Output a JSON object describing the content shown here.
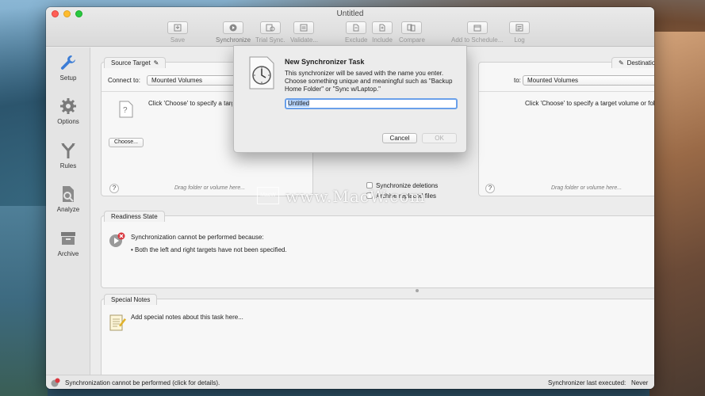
{
  "window": {
    "title": "Untitled"
  },
  "toolbar": {
    "items": [
      {
        "label": "Save",
        "icon": "save-icon"
      },
      {
        "label": "Synchronize",
        "icon": "play-icon"
      },
      {
        "label": "Trial Sync.",
        "icon": "trial-sync-icon"
      },
      {
        "label": "Validate...",
        "icon": "checklist-icon"
      },
      {
        "label": "Exclude",
        "icon": "exclude-icon"
      },
      {
        "label": "Include",
        "icon": "include-icon"
      },
      {
        "label": "Compare",
        "icon": "compare-icon"
      },
      {
        "label": "Add to Schedule...",
        "icon": "schedule-icon"
      },
      {
        "label": "Log",
        "icon": "log-icon"
      }
    ]
  },
  "sidebar": {
    "items": [
      {
        "label": "Setup",
        "icon": "wrench-icon"
      },
      {
        "label": "Options",
        "icon": "gear-icon"
      },
      {
        "label": "Rules",
        "icon": "rules-icon"
      },
      {
        "label": "Analyze",
        "icon": "analyze-icon"
      },
      {
        "label": "Archive",
        "icon": "archive-icon"
      }
    ]
  },
  "source": {
    "tab": "Source Target",
    "connect_label": "Connect to:",
    "connect_value": "Mounted Volumes",
    "instruction": "Click 'Choose' to specify a target volume or folder...",
    "choose_button": "Choose...",
    "help": "?",
    "drag_hint": "Drag folder or volume here..."
  },
  "destination": {
    "tab": "Destination Target",
    "connect_label": "to:",
    "connect_value": "Mounted Volumes",
    "instruction": "Click 'Choose' to specify a target volume or folder...",
    "help": "?",
    "drag_hint": "Drag folder or volume here..."
  },
  "middle": {
    "sync_deletions": "Synchronize deletions",
    "archive_replaced": "Archive replaced files"
  },
  "readiness": {
    "tab": "Readiness State",
    "heading": "Synchronization cannot be performed because:",
    "reason": "•  Both the left and right targets have not been specified.",
    "help": "?"
  },
  "notes": {
    "tab": "Special Notes",
    "placeholder": "Add special notes about this task here..."
  },
  "status": {
    "left": "Synchronization cannot be performed (click for details).",
    "right_label": "Synchronizer last executed:",
    "right_value": "Never"
  },
  "dialog": {
    "title": "New Synchronizer Task",
    "body": "This synchronizer will be saved with the name you enter. Choose something unique and meaningful such as \"Backup Home Folder\" or \"Sync w/Laptop.\"",
    "input_value": "Untitled",
    "cancel": "Cancel",
    "ok": "OK"
  },
  "watermark": {
    "text": "www.MacW.com",
    "box": "MacW"
  },
  "colors": {
    "accent": "#6aa0ea",
    "error": "#d9363e",
    "selection": "#b3d2fb"
  }
}
